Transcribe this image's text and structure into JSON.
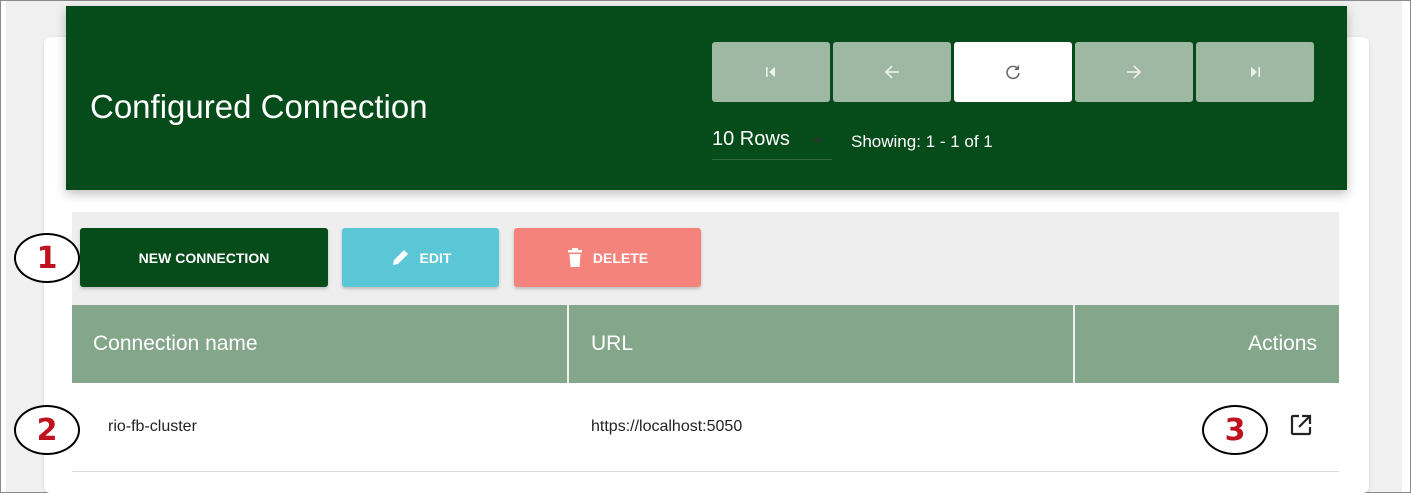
{
  "header": {
    "title": "Configured Connection",
    "rows_label": "10 Rows",
    "showing": "Showing: 1 - 1 of 1"
  },
  "pager": {
    "first_icon": "first-page-icon",
    "prev_icon": "arrow-left-icon",
    "refresh_icon": "refresh-icon",
    "next_icon": "arrow-right-icon",
    "last_icon": "last-page-icon"
  },
  "toolbar": {
    "new_label": "NEW CONNECTION",
    "edit_label": "EDIT",
    "delete_label": "DELETE"
  },
  "table": {
    "columns": [
      "Connection name",
      "URL",
      "Actions"
    ],
    "rows": [
      {
        "name": "rio-fb-cluster",
        "url": "https://localhost:5050",
        "action_icon": "open-in-new-icon"
      }
    ]
  },
  "callouts": [
    "1",
    "2",
    "3"
  ],
  "colors": {
    "header_bg": "#064b1a",
    "table_header_bg": "#84a68b",
    "edit_bg": "#5bc6d6",
    "delete_bg": "#f4837b",
    "callout_text": "#c0111f"
  }
}
